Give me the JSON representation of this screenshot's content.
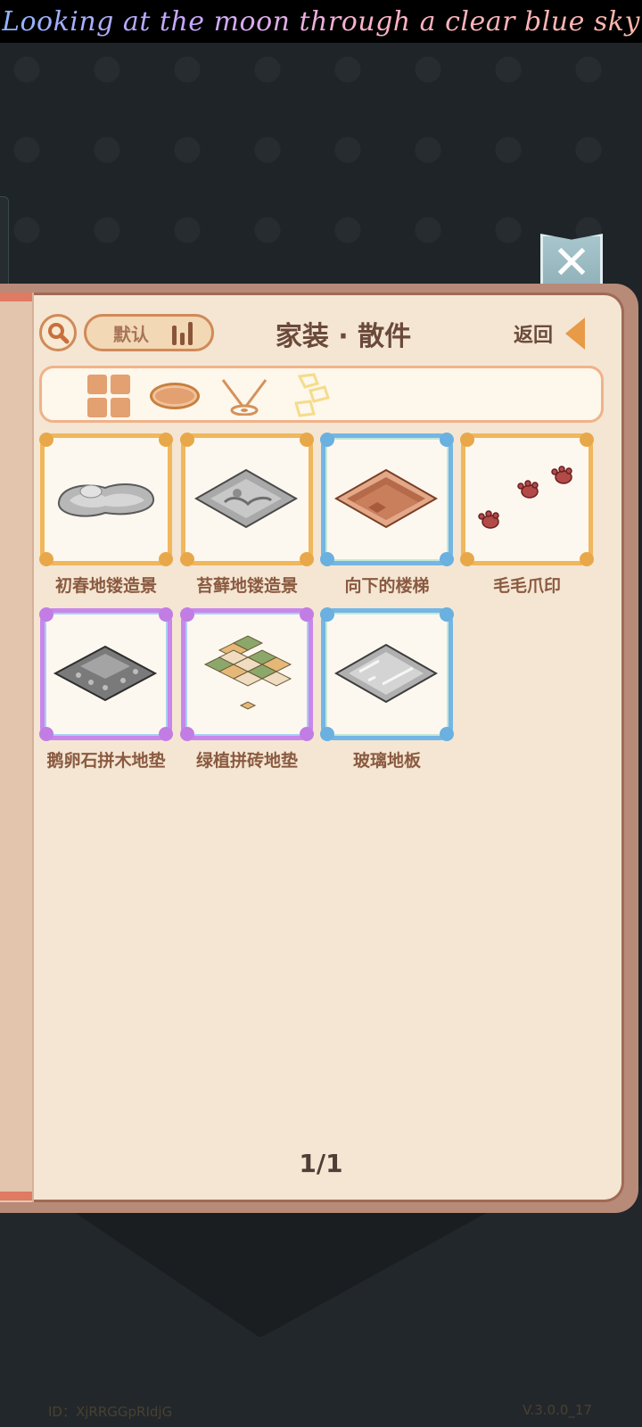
{
  "banner": {
    "text": "Looking at the moon through a clear blue sky"
  },
  "footer": {
    "id_text": "ID：XjRRGGpRIdjG",
    "version": "V.3.0.0_17"
  },
  "header": {
    "sort_label": "默认",
    "title": "家装 · 散件",
    "back_label": "返回"
  },
  "categories": [
    {
      "name": "all",
      "icon": "grid-icon",
      "active": false
    },
    {
      "name": "rug",
      "icon": "rug-icon",
      "active": false
    },
    {
      "name": "hanging",
      "icon": "hanging-lamp-icon",
      "active": false
    },
    {
      "name": "scatter",
      "icon": "scattered-tiles-icon",
      "active": true
    }
  ],
  "items": [
    {
      "name": "初春地镂造景",
      "frame": "gold"
    },
    {
      "name": "苔藓地镂造景",
      "frame": "gold"
    },
    {
      "name": "向下的楼梯",
      "frame": "blue"
    },
    {
      "name": "毛毛爪印",
      "frame": "gold"
    },
    {
      "name": "鹅卵石拼木地垫",
      "frame": "purple"
    },
    {
      "name": "绿植拼砖地垫",
      "frame": "purple"
    },
    {
      "name": "玻璃地板",
      "frame": "blue"
    }
  ],
  "pager": {
    "text": "1/1"
  },
  "colors": {
    "panel_bg": "#f4e6d3",
    "title_text": "#6b4a3a",
    "accent_orange": "#e89a46",
    "frame_gold": "#f0b75c",
    "frame_blue": "#74b6e4",
    "frame_purple": "#c887ea"
  }
}
